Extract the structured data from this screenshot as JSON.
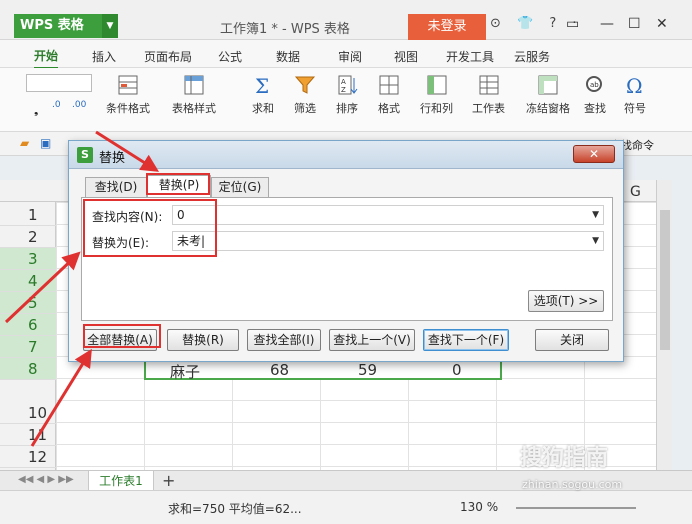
{
  "app": {
    "logo": "WPS 表格",
    "doc_title": "工作簿1 * - WPS 表格",
    "login": "未登录",
    "title_icons": "⊙ 👕 ? ·"
  },
  "menu": {
    "tabs": [
      "开始",
      "插入",
      "页面布局",
      "公式",
      "数据",
      "审阅",
      "视图",
      "开发工具",
      "云服务"
    ]
  },
  "ribbon": {
    "items": [
      "条件格式",
      "表格样式",
      "求和",
      "筛选",
      "排序",
      "格式",
      "行和列",
      "工作表",
      "冻结窗格",
      "查找",
      "符号"
    ],
    "num_formats": [
      ".0",
      ".00"
    ],
    "right_hint": "查找命令"
  },
  "sheet": {
    "col_g": "G",
    "rows": [
      "1",
      "2",
      "3",
      "4",
      "5",
      "6",
      "7",
      "8",
      "10",
      "11",
      "12"
    ],
    "data_row": [
      "麻子",
      "68",
      "59",
      "0"
    ]
  },
  "dialog": {
    "title": "替换",
    "tabs": [
      "查找(D)",
      "替换(P)",
      "定位(G)"
    ],
    "find_label": "查找内容(N):",
    "find_value": "0",
    "replace_label": "替换为(E):",
    "replace_value": "未考|",
    "options_button": "选项(T) >>",
    "buttons": [
      "全部替换(A)",
      "替换(R)",
      "查找全部(I)",
      "查找上一个(V)",
      "查找下一个(F)",
      "关闭"
    ]
  },
  "tabs_bar": {
    "sheet_name": "工作表1",
    "add": "+"
  },
  "status": {
    "summary": "求和=750  平均值=62...",
    "zoom": "130 %"
  },
  "watermark": {
    "brand": "搜狗指南",
    "url": "zhinan.sogou.com"
  },
  "colors": {
    "wps_green": "#3d9e3d",
    "login_orange": "#e8603b",
    "highlight_red": "#e03131",
    "cell_border": "#4aa84a"
  }
}
